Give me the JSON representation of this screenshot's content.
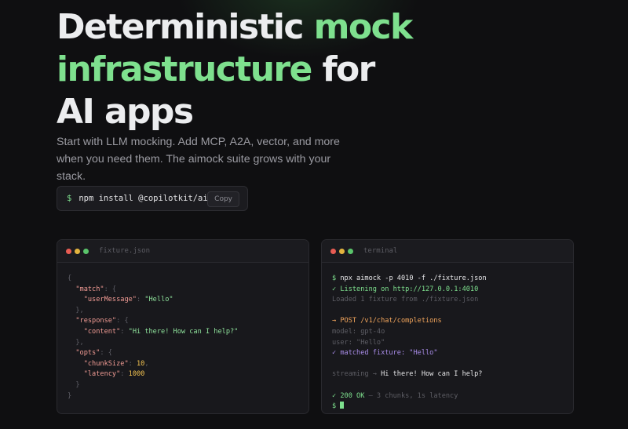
{
  "hero": {
    "title_part1": "Deterministic ",
    "title_accent1": "mock",
    "title_accent2": "infrastructure",
    "title_part2": " for AI apps",
    "subtitle": "Start with LLM mocking. Add MCP, A2A, vector, and more when you need them. The aimock suite grows with your stack."
  },
  "install": {
    "prompt": "$",
    "command": "npm install @copilotkit/aimock",
    "copy_label": "Copy"
  },
  "fixture_panel": {
    "title": "fixture.json",
    "lines": [
      [
        {
          "t": "{",
          "c": "punc"
        }
      ],
      [
        {
          "t": "  ",
          "c": "punc"
        },
        {
          "t": "\"match\"",
          "c": "key"
        },
        {
          "t": ": {",
          "c": "punc"
        }
      ],
      [
        {
          "t": "    ",
          "c": "punc"
        },
        {
          "t": "\"userMessage\"",
          "c": "key"
        },
        {
          "t": ": ",
          "c": "punc"
        },
        {
          "t": "\"Hello\"",
          "c": "str"
        }
      ],
      [
        {
          "t": "  },",
          "c": "punc"
        }
      ],
      [
        {
          "t": "  ",
          "c": "punc"
        },
        {
          "t": "\"response\"",
          "c": "key"
        },
        {
          "t": ": {",
          "c": "punc"
        }
      ],
      [
        {
          "t": "    ",
          "c": "punc"
        },
        {
          "t": "\"content\"",
          "c": "key"
        },
        {
          "t": ": ",
          "c": "punc"
        },
        {
          "t": "\"Hi there! How can I help?\"",
          "c": "str"
        }
      ],
      [
        {
          "t": "  },",
          "c": "punc"
        }
      ],
      [
        {
          "t": "  ",
          "c": "punc"
        },
        {
          "t": "\"opts\"",
          "c": "key"
        },
        {
          "t": ": {",
          "c": "punc"
        }
      ],
      [
        {
          "t": "    ",
          "c": "punc"
        },
        {
          "t": "\"chunkSize\"",
          "c": "key"
        },
        {
          "t": ": ",
          "c": "punc"
        },
        {
          "t": "10",
          "c": "num"
        },
        {
          "t": ",",
          "c": "punc"
        }
      ],
      [
        {
          "t": "    ",
          "c": "punc"
        },
        {
          "t": "\"latency\"",
          "c": "key"
        },
        {
          "t": ": ",
          "c": "punc"
        },
        {
          "t": "1000",
          "c": "num"
        }
      ],
      [
        {
          "t": "  }",
          "c": "punc"
        }
      ],
      [
        {
          "t": "}",
          "c": "punc"
        }
      ]
    ]
  },
  "terminal_panel": {
    "title": "terminal",
    "lines": [
      [
        {
          "t": "$ ",
          "c": "c-green"
        },
        {
          "t": "npx aimock -p 4010 -f ./fixture.json",
          "c": "c-white"
        }
      ],
      [
        {
          "t": "✓ Listening on http://127.0.0.1:4010",
          "c": "c-green"
        }
      ],
      [
        {
          "t": "Loaded 1 fixture from ./fixture.json",
          "c": "c-gray"
        }
      ],
      [],
      [
        {
          "t": "→ POST /v1/chat/completions",
          "c": "c-orange"
        }
      ],
      [
        {
          "t": "model: gpt-4o",
          "c": "c-gray"
        }
      ],
      [
        {
          "t": "user: \"Hello\"",
          "c": "c-gray"
        }
      ],
      [
        {
          "t": "✓ matched fixture: \"Hello\"",
          "c": "c-purple"
        }
      ],
      [],
      [
        {
          "t": "streaming → ",
          "c": "c-gray"
        },
        {
          "t": "Hi there! How can I help?",
          "c": "c-white"
        }
      ],
      [],
      [
        {
          "t": "✓ 200 OK",
          "c": "c-green"
        },
        {
          "t": " — 3 chunks, 1s latency",
          "c": "c-gray"
        }
      ],
      [
        {
          "t": "$ ",
          "c": "c-green"
        }
      ]
    ]
  },
  "colors": {
    "accent": "#7ee08e",
    "background": "#0f0f11",
    "panel": "#18181c"
  }
}
